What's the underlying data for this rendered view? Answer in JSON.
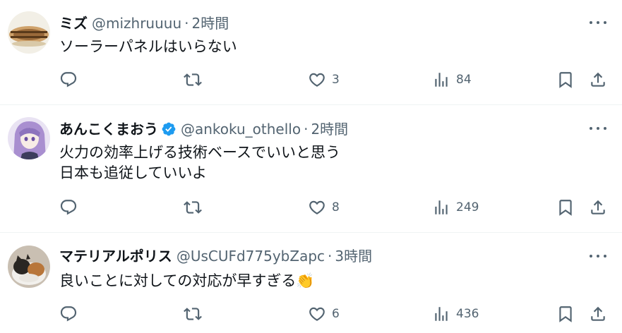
{
  "tweets": [
    {
      "name": "ミズ",
      "handle": "@mizhruuuu",
      "time": "2時間",
      "verified": false,
      "lines": [
        "ソーラーパネルはいらない"
      ],
      "likes": "3",
      "views": "84",
      "avatar_color": "#d9c9a8"
    },
    {
      "name": "あんこくまおう",
      "handle": "@ankoku_othello",
      "time": "2時間",
      "verified": true,
      "lines": [
        "火力の効率上げる技術ベースでいいと思う",
        "日本も追従していいよ"
      ],
      "likes": "8",
      "views": "249",
      "avatar_color": "#b9a7d8"
    },
    {
      "name": "マテリアルポリス",
      "handle": "@UsCUFd775ybZapc",
      "time": "3時間",
      "verified": false,
      "lines": [
        "良いことに対しての対応が早すぎる👏"
      ],
      "likes": "6",
      "views": "436",
      "avatar_color": "#8a7a6a"
    }
  ],
  "separator": "·",
  "colors": {
    "text": "#0f1419",
    "secondary": "#536471",
    "verified_blue": "#1d9bf0",
    "divider": "#eff3f4"
  },
  "icons": [
    "reply-icon",
    "retweet-icon",
    "like-icon",
    "views-icon",
    "bookmark-icon",
    "share-icon",
    "more-icon",
    "verified-badge-icon"
  ]
}
